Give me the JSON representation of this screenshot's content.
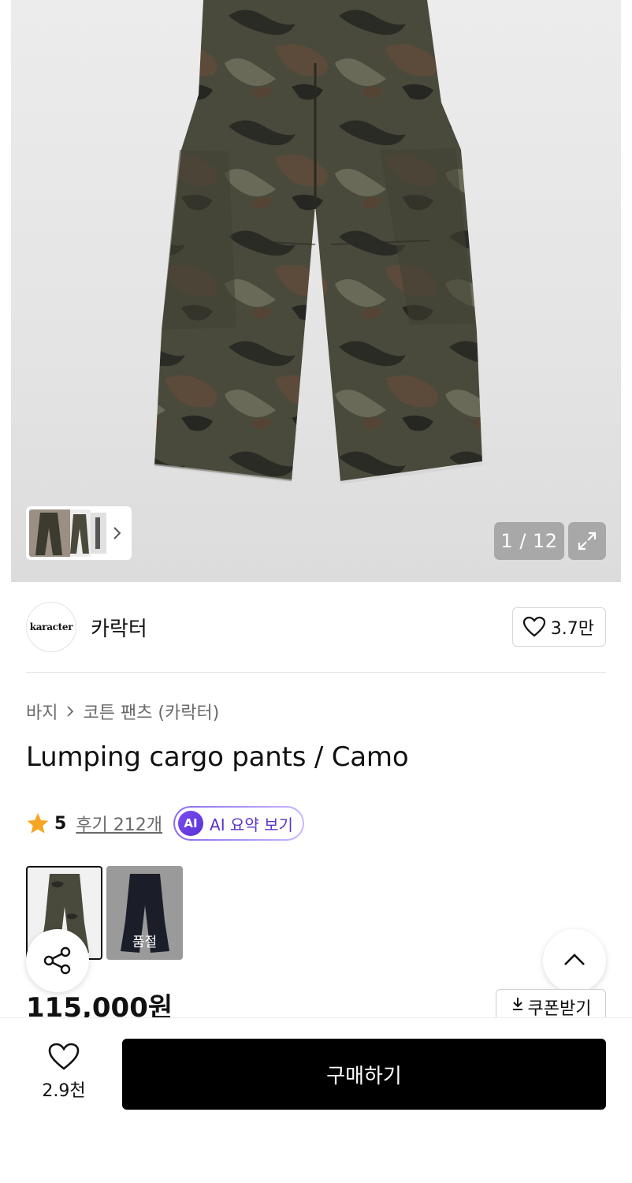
{
  "gallery": {
    "counter": "1 / 12",
    "icons": {
      "expand": "expand-arrows-icon",
      "next": "chevron-right-icon"
    }
  },
  "brand": {
    "logo_text": "karacter",
    "name": "카락터",
    "like_count": "3.7만",
    "icons": {
      "like": "heart-outline-icon"
    }
  },
  "breadcrumb": {
    "category": "바지",
    "subcategory": "코튼 팬츠 (카락터)"
  },
  "product": {
    "title": "Lumping cargo pants / Camo",
    "rating": "5",
    "reviews": "후기 212개",
    "ai_badge": "AI",
    "ai_summary": "AI 요약 보기",
    "price": "115,000원",
    "coupon": "쿠폰받기"
  },
  "options": [
    {
      "color": "camo",
      "selected": true
    },
    {
      "color": "black",
      "status": "품절"
    }
  ],
  "bottom_bar": {
    "like_count": "2.9천",
    "buy_label": "구매하기"
  },
  "colors": {
    "accent_ai": "#5b34c8",
    "star": "#f5a623",
    "buy_button": "#000000"
  }
}
